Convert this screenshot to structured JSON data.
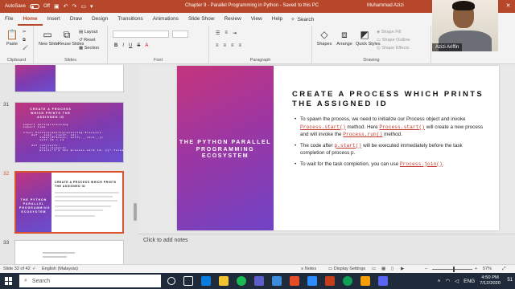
{
  "app": {
    "autosave_label": "AutoSave",
    "autosave_state": "Off",
    "title": "Chapter 9 - Parallel Programming in Python  -  Saved to this PC",
    "user": "Muhammad Azizi",
    "accent": "#b7472a"
  },
  "tabs": [
    "File",
    "Home",
    "Insert",
    "Draw",
    "Design",
    "Transitions",
    "Animations",
    "Slide Show",
    "Review",
    "View",
    "Help"
  ],
  "active_tab": "Home",
  "search_label": "Search",
  "ribbon": {
    "paste": "Paste",
    "new_slide": "New Slide",
    "reuse_slides": "Reuse Slides",
    "layout": "Layout",
    "reset": "Reset",
    "section": "Section",
    "shapes": "Shapes",
    "arrange": "Arrange",
    "quick_styles": "Quick Styles",
    "shape_fill": "Shape Fill",
    "shape_outline": "Shape Outline",
    "shape_effects": "Shape Effects",
    "groups": {
      "clipboard": "Clipboard",
      "slides": "Slides",
      "font": "Font",
      "paragraph": "Paragraph",
      "drawing": "Drawing"
    }
  },
  "thumbnails": [
    {
      "number": "31",
      "title": "CREATE A PROCESS WHICH PRINTS THE ASSIGNED ID",
      "code": "import multiprocessing\nimport time\n\nclass Process(multiprocessing.Process):\n    def __init__(self, id):\n        super(Process, self).__init__()\n        self.id = id\n\n    def run(self):\n        time.sleep(1)\n        print(\"I'm the process with id: {}\".format(self.id))"
    },
    {
      "number": "32",
      "left_title": "THE PYTHON PARALLEL PROGRAMMING ECOSYSTEM",
      "title": "CREATE A PROCESS WHICH PRINTS THE ASSIGNED ID"
    },
    {
      "number": "33"
    }
  ],
  "slide": {
    "left_title": "THE PYTHON PARALLEL PROGRAMMING ECOSYSTEM",
    "title": "CREATE A PROCESS WHICH PRINTS THE ASSIGNED ID",
    "bullets": [
      {
        "t1": "To spawn the process, we need to initialize our Process object and invoke ",
        "c1": "Process.start()",
        "t2": " method. Here ",
        "c2": "Process.start()",
        "t3": " will create a new process and will invoke the ",
        "c3": "Process.run()",
        "t4": " method."
      },
      {
        "t1": "The code after ",
        "c1": "p.start()",
        "t2": " will be executed immediately before the task completion of process p.",
        "c2": "",
        "t3": "",
        "c3": "",
        "t4": ""
      },
      {
        "t1": "To wait for the task completion, you can use ",
        "c1": "Process.join()",
        "t2": ".",
        "c2": "",
        "t3": "",
        "c3": "",
        "t4": ""
      }
    ]
  },
  "notes_placeholder": "Click to add notes",
  "status": {
    "slide_counter": "Slide 32 of 42",
    "language": "English (Malaysia)",
    "notes": "Notes",
    "display_settings": "Display Settings",
    "zoom": "57%"
  },
  "webcam": {
    "name": "Azizi Ariffin"
  },
  "taskbar": {
    "search": "Search",
    "language": "ENG",
    "time": "4:50 PM",
    "date": "7/12/2020",
    "notification": "51"
  }
}
